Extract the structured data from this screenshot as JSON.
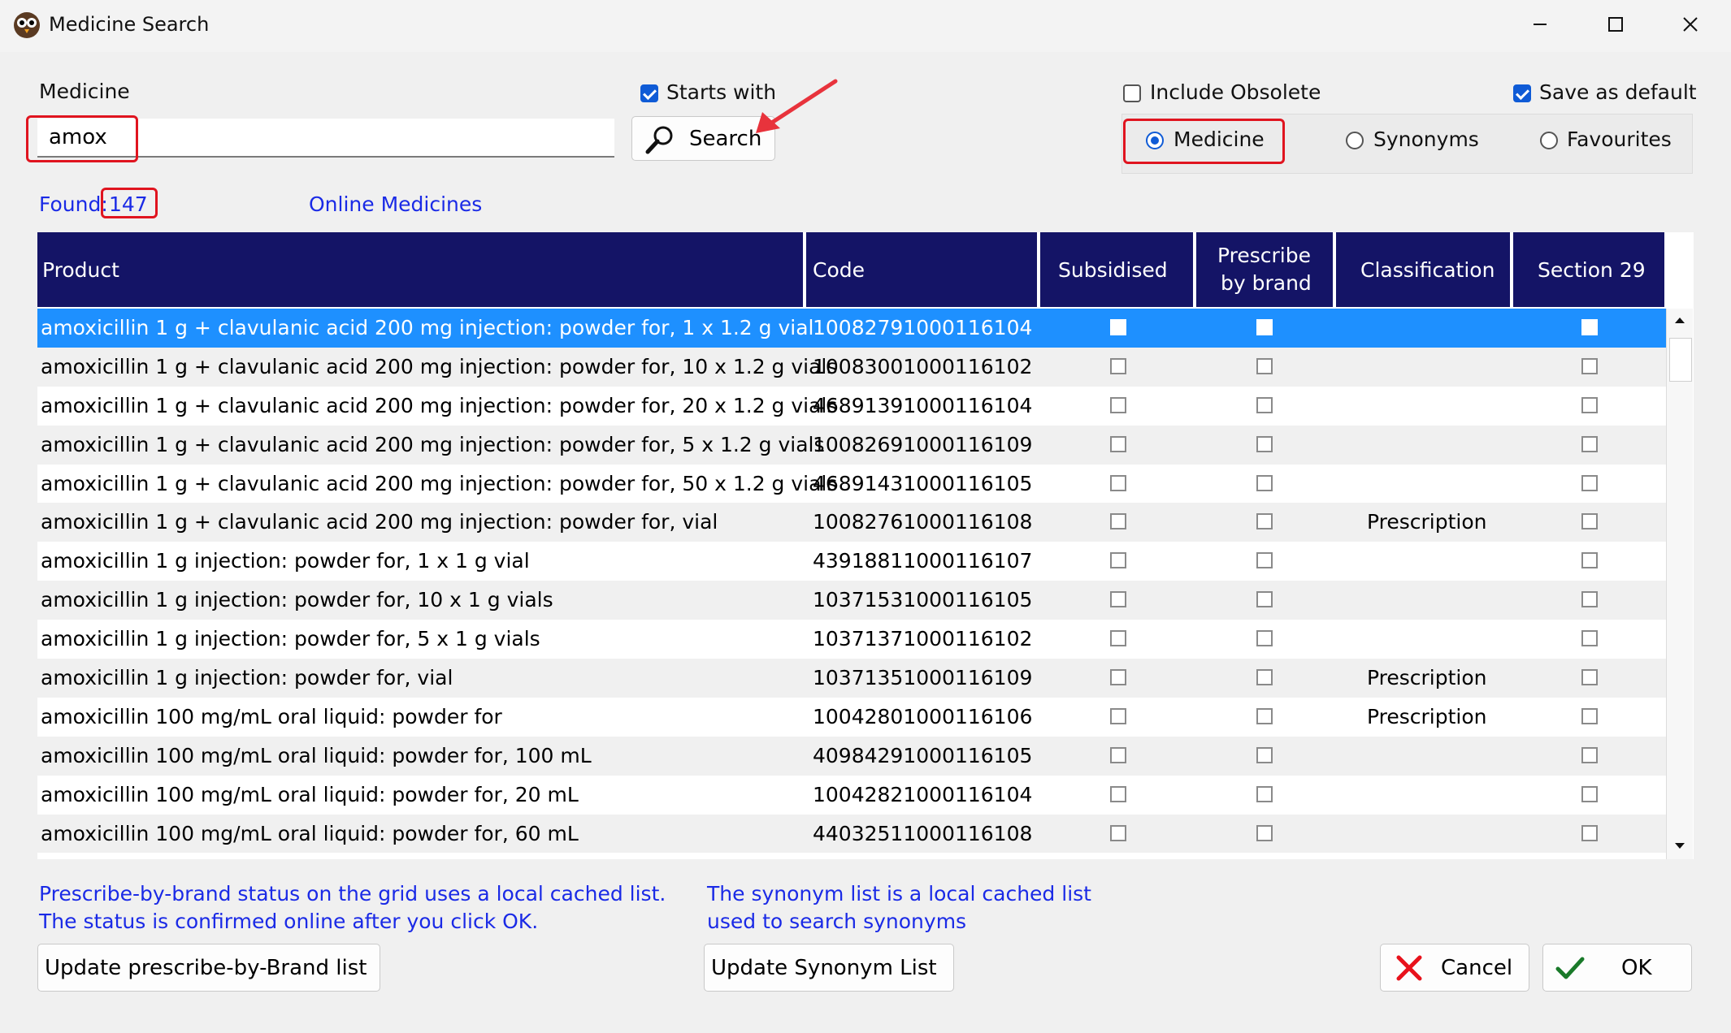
{
  "window": {
    "title": "Medicine Search"
  },
  "search": {
    "label": "Medicine",
    "value": "amox",
    "starts_with_label": "Starts with",
    "starts_with_checked": true,
    "button_label": "Search"
  },
  "options": {
    "include_obsolete_label": "Include Obsolete",
    "include_obsolete_checked": false,
    "save_default_label": "Save as default",
    "save_default_checked": true,
    "mode_medicine": "Medicine",
    "mode_synonyms": "Synonyms",
    "mode_favourites": "Favourites",
    "selected_mode": "Medicine"
  },
  "found": {
    "label": "Found:",
    "count": "147"
  },
  "online_link": "Online Medicines",
  "grid": {
    "columns": [
      "Product",
      "Code",
      "Subsidised",
      "Prescribe",
      "by brand",
      "Classification",
      "Section 29"
    ],
    "rows": [
      {
        "product": "amoxicillin 1 g + clavulanic acid 200 mg injection: powder for, 1 x 1.2 g vial",
        "code": "10082791000116104",
        "classification": ""
      },
      {
        "product": "amoxicillin 1 g + clavulanic acid 200 mg injection: powder for, 10 x 1.2 g vials",
        "code": "10083001000116102",
        "classification": ""
      },
      {
        "product": "amoxicillin 1 g + clavulanic acid 200 mg injection: powder for, 20 x 1.2 g vials",
        "code": "46891391000116104",
        "classification": ""
      },
      {
        "product": "amoxicillin 1 g + clavulanic acid 200 mg injection: powder for, 5 x 1.2 g vials",
        "code": "10082691000116109",
        "classification": ""
      },
      {
        "product": "amoxicillin 1 g + clavulanic acid 200 mg injection: powder for, 50 x 1.2 g vials",
        "code": "46891431000116105",
        "classification": ""
      },
      {
        "product": "amoxicillin 1 g + clavulanic acid 200 mg injection: powder for, vial",
        "code": "10082761000116108",
        "classification": "Prescription"
      },
      {
        "product": "amoxicillin 1 g injection: powder for, 1 x 1 g vial",
        "code": "43918811000116107",
        "classification": ""
      },
      {
        "product": "amoxicillin 1 g injection: powder for, 10 x 1 g vials",
        "code": "10371531000116105",
        "classification": ""
      },
      {
        "product": "amoxicillin 1 g injection: powder for, 5 x 1 g vials",
        "code": "10371371000116102",
        "classification": ""
      },
      {
        "product": "amoxicillin 1 g injection: powder for, vial",
        "code": "10371351000116109",
        "classification": "Prescription"
      },
      {
        "product": "amoxicillin 100 mg/mL oral liquid: powder for",
        "code": "10042801000116106",
        "classification": "Prescription"
      },
      {
        "product": "amoxicillin 100 mg/mL oral liquid: powder for, 100 mL",
        "code": "40984291000116105",
        "classification": ""
      },
      {
        "product": "amoxicillin 100 mg/mL oral liquid: powder for, 20 mL",
        "code": "10042821000116104",
        "classification": ""
      },
      {
        "product": "amoxicillin 100 mg/mL oral liquid: powder for, 60 mL",
        "code": "44032511000116108",
        "classification": ""
      }
    ]
  },
  "notes": {
    "brand_line1": "Prescribe-by-brand status on the grid uses a local cached list.",
    "brand_line2": "The status is confirmed online after you click OK.",
    "synonym_line1": "The synonym list is a local cached list",
    "synonym_line2": "used to search synonyms"
  },
  "buttons": {
    "update_brand": "Update prescribe-by-Brand list",
    "update_synonym": "Update Synonym List",
    "cancel": "Cancel",
    "ok": "OK"
  },
  "colors": {
    "header_bg": "#141466",
    "selection": "#1e90ff",
    "annotation": "#e0141f",
    "link": "#1a2ae6"
  }
}
